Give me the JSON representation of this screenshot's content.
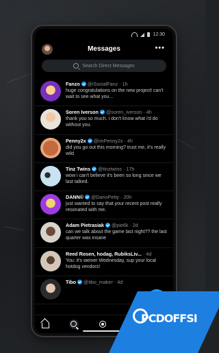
{
  "status_bar": {
    "time": "12:30"
  },
  "header": {
    "title": "Messages",
    "more_label": "•••"
  },
  "search": {
    "placeholder": "Search Direct Messages"
  },
  "conversations": [
    {
      "name": "Fanzo",
      "verified": true,
      "handle": "@iSocialFanz",
      "time": "1h",
      "message": "huge congratulations on the new project! can't wait to see what you...",
      "avatar_color": "#7b2fbd"
    },
    {
      "name": "Soren Iverson",
      "verified": true,
      "handle": "@soren_iverson",
      "time": "4h",
      "message": "thank you so much. i don't know what i'd do without you.",
      "avatar_color": "#e8e3da"
    },
    {
      "name": "Penny2x",
      "verified": true,
      "handle": "@imPenny2x",
      "time": "4h",
      "message": "did you go out this morning? trust me, it's really wild",
      "avatar_color": "#c46a3f"
    },
    {
      "name": "Tinz Twins",
      "verified": true,
      "handle": "@tinztwins",
      "time": "17h",
      "message": "wow i can't believe it's been so long since we last talked.",
      "avatar_color": "#c7e2f2"
    },
    {
      "name": "DANN©",
      "verified": true,
      "handle": "@DannPetty",
      "time": "20h",
      "message": "just wanted to say that your recent post really resonated with me.",
      "avatar_color": "#9c3ce0"
    },
    {
      "name": "Adam Pietrasiak",
      "verified": true,
      "handle": "@pie6k",
      "time": "2d",
      "message": "can we talk about the game last night?? the last quarter was insane",
      "avatar_color": "#d8d4cc"
    },
    {
      "name": "Reed Rosen, hodag, RubiksLiv...",
      "verified": false,
      "handle": "",
      "time": "4d",
      "message": "You: it's weiner Wednesday, sup your local hotdog vendors!",
      "avatar_color": "#d4c7b9"
    },
    {
      "name": "Tibo",
      "verified": true,
      "handle": "@tibo_maker",
      "time": "4d",
      "message": "",
      "avatar_color": "#2b2b2b"
    }
  ],
  "fab": {
    "label": "New message"
  },
  "tabs": [
    {
      "name": "home-icon"
    },
    {
      "name": "search-icon"
    },
    {
      "name": "spaces-icon"
    },
    {
      "name": "bell-icon"
    },
    {
      "name": "mail-icon"
    }
  ],
  "watermark": {
    "text": "PCDOFFSI"
  },
  "colors": {
    "accent": "#1d9bf0",
    "background": "#000000",
    "watermark": "#1d7fe0"
  }
}
